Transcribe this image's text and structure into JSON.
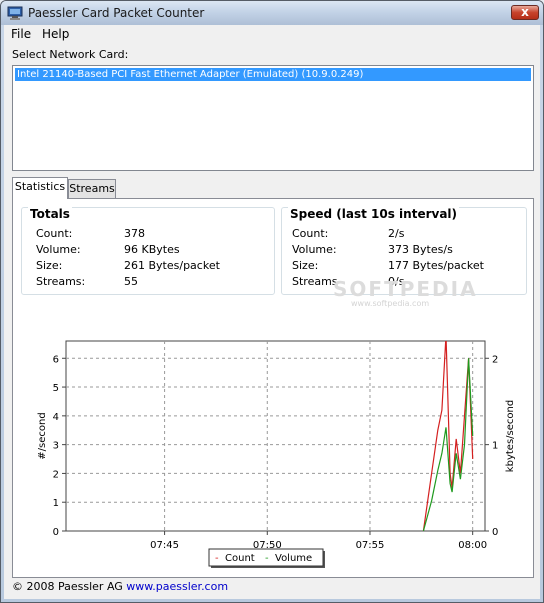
{
  "window": {
    "title": "Paessler Card Packet Counter",
    "close_glyph": "x",
    "titlebar_color": "#c3d3e7",
    "close_color": "#c7432c"
  },
  "menu": {
    "items": [
      "File",
      "Help"
    ]
  },
  "network": {
    "select_label": "Select Network Card:",
    "selected_card": "Intel 21140-Based PCI Fast Ethernet Adapter (Emulated) (10.9.0.249)",
    "selection_color": "#3399ff"
  },
  "tabs": [
    {
      "label": "Statistics",
      "active": true
    },
    {
      "label": "Streams",
      "active": false
    }
  ],
  "totals": {
    "title": "Totals",
    "rows": [
      {
        "label": "Count:",
        "value": "378"
      },
      {
        "label": "Volume:",
        "value": "96 KBytes"
      },
      {
        "label": "Size:",
        "value": "261 Bytes/packet"
      },
      {
        "label": "Streams:",
        "value": "55"
      }
    ]
  },
  "speed": {
    "title": "Speed (last 10s interval)",
    "rows": [
      {
        "label": "Count:",
        "value": "2/s"
      },
      {
        "label": "Volume:",
        "value": "373 Bytes/s"
      },
      {
        "label": "Size:",
        "value": "177 Bytes/packet"
      },
      {
        "label": "Streams",
        "value": "0/s"
      }
    ]
  },
  "watermark": {
    "text": "SOFTPEDIA",
    "url": "www.softpedia.com"
  },
  "chart_data": {
    "type": "line",
    "xlabel": "",
    "ylabel": "#/second",
    "y2label": "kbytes/second",
    "x_ticks": [
      "07:45",
      "07:50",
      "07:55",
      "08:00"
    ],
    "ylim": [
      0,
      6.6
    ],
    "y_ticks": [
      0,
      1,
      2,
      3,
      4,
      5,
      6
    ],
    "y2lim": [
      0,
      2.2
    ],
    "y2_ticks": [
      0,
      1,
      2
    ],
    "grid": true,
    "x_minutes": [
      57.6,
      58.0,
      58.3,
      58.5,
      58.7,
      58.9,
      59.0,
      59.2,
      59.4,
      59.6,
      59.8,
      60.0
    ],
    "series": [
      {
        "name": "Count",
        "axis": "left",
        "color": "#d42020",
        "values": [
          0,
          2.0,
          3.5,
          4.2,
          6.8,
          2.0,
          1.5,
          3.2,
          2.0,
          4.0,
          6.0,
          2.5
        ]
      },
      {
        "name": "Volume",
        "axis": "right",
        "color": "#1f9a1f",
        "values": [
          0,
          0.35,
          0.7,
          0.9,
          1.2,
          0.55,
          0.45,
          0.9,
          0.6,
          1.0,
          2.0,
          1.1
        ]
      }
    ],
    "legend": {
      "position": "bottom-center",
      "entries": [
        "Count",
        "Volume"
      ],
      "marker": "-"
    }
  },
  "footer": {
    "copyright": "© 2008 Paessler AG",
    "link": "www.paessler.com"
  }
}
